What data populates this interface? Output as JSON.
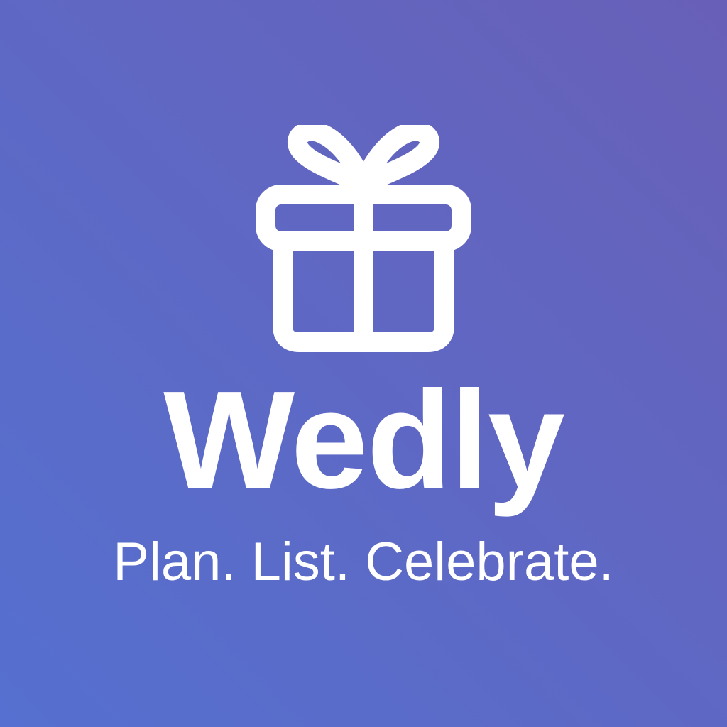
{
  "app": {
    "name": "Wedly",
    "tagline": "Plan. List. Celebrate."
  },
  "theme": {
    "gradient_start": "#5570d0",
    "gradient_end": "#6860b8",
    "foreground": "#ffffff"
  },
  "icons": {
    "logo": "gift-icon"
  }
}
